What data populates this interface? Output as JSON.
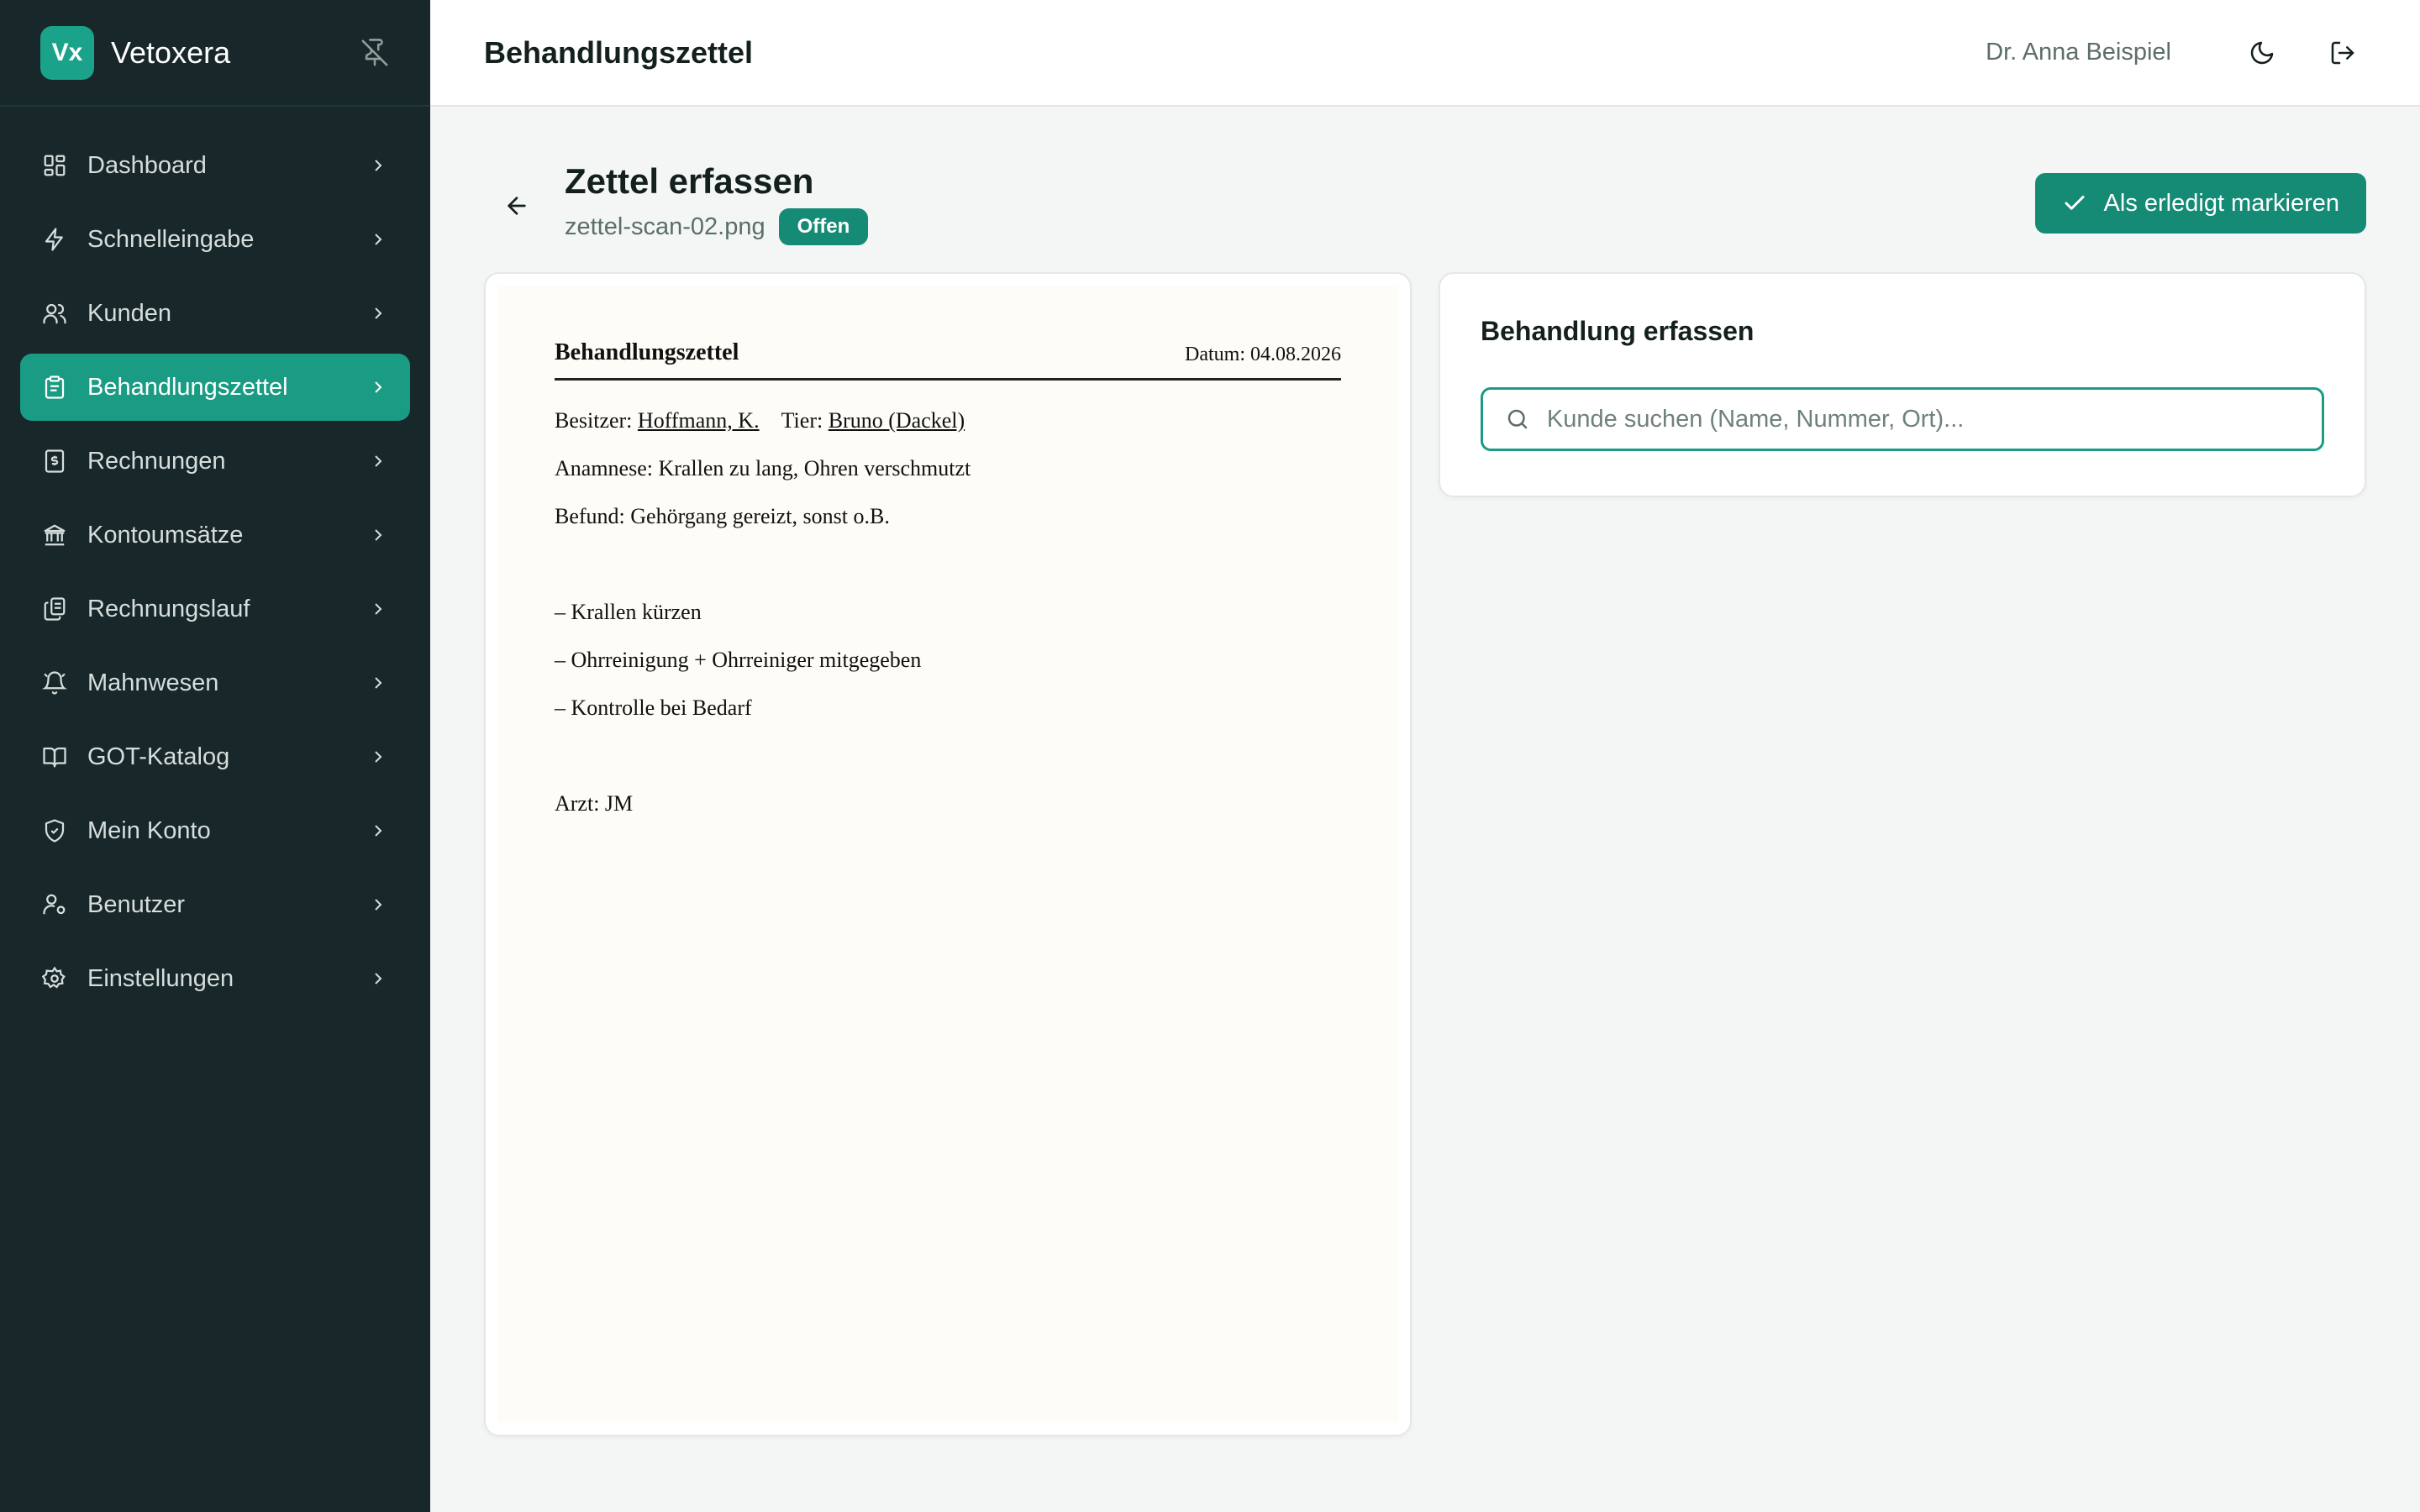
{
  "app": {
    "logo_text": "Vx",
    "name": "Vetoxera"
  },
  "sidebar": {
    "items": [
      {
        "label": "Dashboard",
        "icon": "dashboard-icon"
      },
      {
        "label": "Schnelleingabe",
        "icon": "lightning-icon"
      },
      {
        "label": "Kunden",
        "icon": "users-icon"
      },
      {
        "label": "Behandlungszettel",
        "icon": "clipboard-icon",
        "active": true
      },
      {
        "label": "Rechnungen",
        "icon": "invoice-icon"
      },
      {
        "label": "Kontoumsätze",
        "icon": "bank-icon"
      },
      {
        "label": "Rechnungslauf",
        "icon": "copy-files-icon"
      },
      {
        "label": "Mahnwesen",
        "icon": "bell-icon"
      },
      {
        "label": "GOT-Katalog",
        "icon": "book-icon"
      },
      {
        "label": "Mein Konto",
        "icon": "shield-icon"
      },
      {
        "label": "Benutzer",
        "icon": "user-cog-icon"
      },
      {
        "label": "Einstellungen",
        "icon": "gear-icon"
      }
    ]
  },
  "header": {
    "title": "Behandlungszettel",
    "user_name": "Dr. Anna Beispiel"
  },
  "page": {
    "title": "Zettel erfassen",
    "filename": "zettel-scan-02.png",
    "status": "Offen",
    "done_button": "Als erledigt markieren"
  },
  "scan": {
    "title": "Behandlungszettel",
    "date": "Datum: 04.08.2026",
    "owner_label": "Besitzer:",
    "owner": "Hoffmann, K.",
    "animal_label": "Tier:",
    "animal": "Bruno (Dackel)",
    "anamnesis": "Anamnese: Krallen zu lang, Ohren verschmutzt",
    "finding": "Befund: Gehörgang gereizt, sonst o.B.",
    "items": [
      "– Krallen kürzen",
      "– Ohrreinigung + Ohrreiniger mitgegeben",
      "– Kontrolle bei Bedarf"
    ],
    "doctor": "Arzt: JM"
  },
  "entry": {
    "title": "Behandlung erfassen",
    "search_placeholder": "Kunde suchen (Name, Nummer, Ort)...",
    "search_value": ""
  },
  "colors": {
    "accent": "#1a9b83",
    "sidebar_bg": "#17272a",
    "badge": "#158a75"
  }
}
